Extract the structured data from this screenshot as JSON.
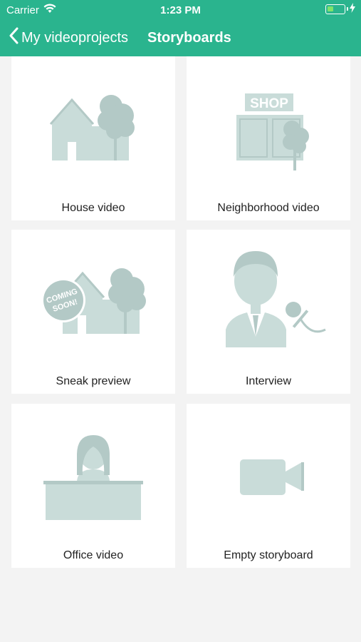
{
  "status_bar": {
    "carrier": "Carrier",
    "time": "1:23 PM",
    "battery_level": 0.35
  },
  "nav": {
    "back_label": "My videoprojects",
    "title": "Storyboards"
  },
  "cards": [
    {
      "label": "House video",
      "icon": "house-icon"
    },
    {
      "label": "Neighborhood video",
      "icon": "shop-icon",
      "sign": "SHOP"
    },
    {
      "label": "Sneak preview",
      "icon": "coming-soon-icon",
      "badge_line1": "COMING",
      "badge_line2": "SOON!"
    },
    {
      "label": "Interview",
      "icon": "interview-icon"
    },
    {
      "label": "Office video",
      "icon": "office-icon"
    },
    {
      "label": "Empty storyboard",
      "icon": "video-camera-icon"
    }
  ],
  "colors": {
    "header": "#2ab48e",
    "illustration": "#c9dcd9",
    "illustration_dark": "#b3c9c6"
  }
}
